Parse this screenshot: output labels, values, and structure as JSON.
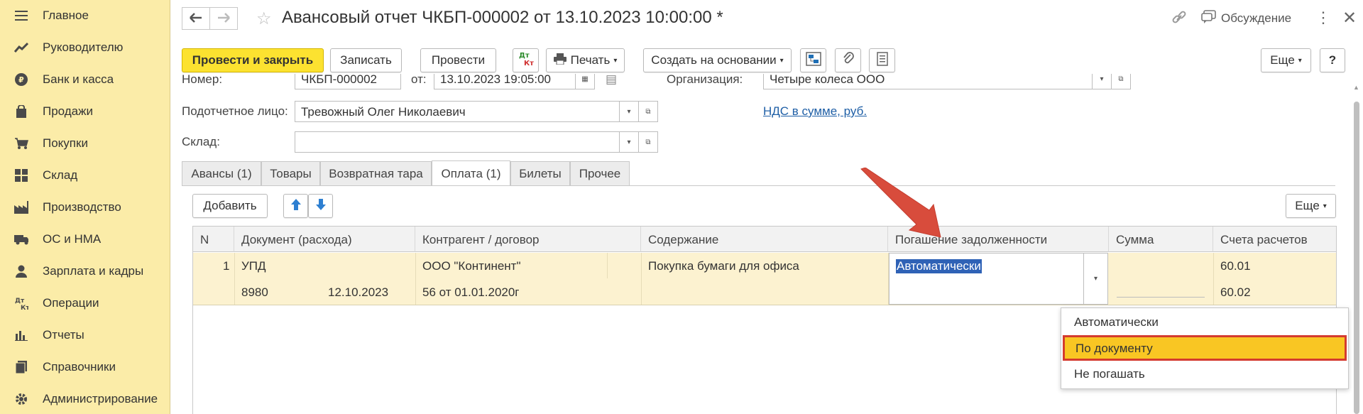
{
  "sidebar": {
    "items": [
      {
        "label": "Главное",
        "icon": "menu-icon"
      },
      {
        "label": "Руководителю",
        "icon": "trend-icon"
      },
      {
        "label": "Банк и касса",
        "icon": "ruble-icon"
      },
      {
        "label": "Продажи",
        "icon": "bag-icon"
      },
      {
        "label": "Покупки",
        "icon": "cart-icon"
      },
      {
        "label": "Склад",
        "icon": "warehouse-icon"
      },
      {
        "label": "Производство",
        "icon": "factory-icon"
      },
      {
        "label": "ОС и НМА",
        "icon": "truck-icon"
      },
      {
        "label": "Зарплата и кадры",
        "icon": "person-icon"
      },
      {
        "label": "Операции",
        "icon": "dt-kt-icon"
      },
      {
        "label": "Отчеты",
        "icon": "bar-chart-icon"
      },
      {
        "label": "Справочники",
        "icon": "book-icon"
      },
      {
        "label": "Администрирование",
        "icon": "gear-icon"
      }
    ]
  },
  "header": {
    "title": "Авансовый отчет ЧКБП-000002 от 13.10.2023 10:00:00 *",
    "discussion_label": "Обсуждение"
  },
  "toolbar": {
    "post_close_label": "Провести и закрыть",
    "save_label": "Записать",
    "post_label": "Провести",
    "dtkt_label": "Дт Кт",
    "print_label": "Печать",
    "create_based_label": "Создать на основании",
    "more_label": "Еще",
    "help_label": "?"
  },
  "form": {
    "number_label": "Номер:",
    "number_value": "ЧКБП-000002",
    "date_label": "от:",
    "date_value": "13.10.2023 19:05:00",
    "org_label": "Организация:",
    "org_value": "Четыре колеса ООО",
    "person_label": "Подотчетное лицо:",
    "person_value": "Тревожный Олег Николаевич",
    "warehouse_label": "Склад:",
    "warehouse_value": "",
    "vat_link": "НДС в сумме, руб."
  },
  "tabs": [
    {
      "label": "Авансы (1)"
    },
    {
      "label": "Товары"
    },
    {
      "label": "Возвратная тара"
    },
    {
      "label": "Оплата (1)"
    },
    {
      "label": "Билеты"
    },
    {
      "label": "Прочее"
    }
  ],
  "table_toolbar": {
    "add_label": "Добавить",
    "more_label": "Еще"
  },
  "table": {
    "columns": [
      "N",
      "Документ (расхода)",
      "Контрагент / договор",
      "Содержание",
      "Погашение задолженности",
      "Сумма",
      "Счета расчетов"
    ],
    "row": {
      "n": "1",
      "doc_type": "УПД",
      "doc_number": "8980",
      "doc_date": "12.10.2023",
      "counterparty": "ООО \"Континент\"",
      "contract": "56 от 01.01.2020г",
      "content": "Покупка бумаги для офиса",
      "repayment": "Автоматически",
      "amount": "",
      "account1": "60.01",
      "account2": "60.02"
    }
  },
  "dropdown": {
    "options": [
      "Автоматически",
      "По документу",
      "Не погашать"
    ],
    "selected": "По документу"
  },
  "colors": {
    "sidebar_bg": "#fbeca8",
    "primary_button": "#fce230",
    "row_highlight": "#fcf2d0",
    "selected_option": "#f9c623",
    "annotation_red": "#d43b2f"
  }
}
